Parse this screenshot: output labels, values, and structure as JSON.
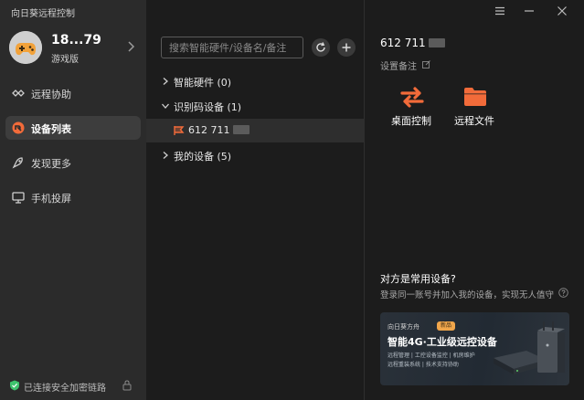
{
  "app": {
    "title": "向日葵远程控制"
  },
  "user": {
    "name": "18...79",
    "tier": "游戏版"
  },
  "sidebar": {
    "items": [
      {
        "label": "远程协助",
        "icon": "remote-assist-icon"
      },
      {
        "label": "设备列表",
        "icon": "device-list-icon"
      },
      {
        "label": "发现更多",
        "icon": "discover-icon"
      },
      {
        "label": "手机投屏",
        "icon": "screen-cast-icon"
      }
    ],
    "active_index": 1,
    "status": "已连接安全加密链路"
  },
  "search": {
    "placeholder": "搜索智能硬件/设备名/备注",
    "value": ""
  },
  "tree": {
    "groups": [
      {
        "label": "智能硬件 (0)",
        "expanded": false
      },
      {
        "label": "识别码设备 (1)",
        "expanded": true
      },
      {
        "label": "我的设备 (5)",
        "expanded": false
      }
    ],
    "device": {
      "label": "612 711"
    }
  },
  "detail": {
    "device_id": "612 711",
    "remark_label": "设置备注",
    "actions": [
      {
        "label": "桌面控制",
        "icon": "desktop-control-icon"
      },
      {
        "label": "远程文件",
        "icon": "folder-icon"
      }
    ]
  },
  "promo": {
    "title": "对方是常用设备?",
    "subtitle": "登录同一账号并加入我的设备，实现无人值守",
    "banner": {
      "brand": "向日葵方舟",
      "tag": "新品",
      "headline": "智能4G·工业级远控设备",
      "line1": "远程管理 | 工控设备监控 | 机房维护",
      "line2": "远程重装系统 | 技术支持协助"
    }
  },
  "colors": {
    "accent": "#f26b3a",
    "sidebar_bg": "#2b2b2b",
    "main_bg": "#1c1c1c",
    "status_ok": "#3ec26d"
  }
}
